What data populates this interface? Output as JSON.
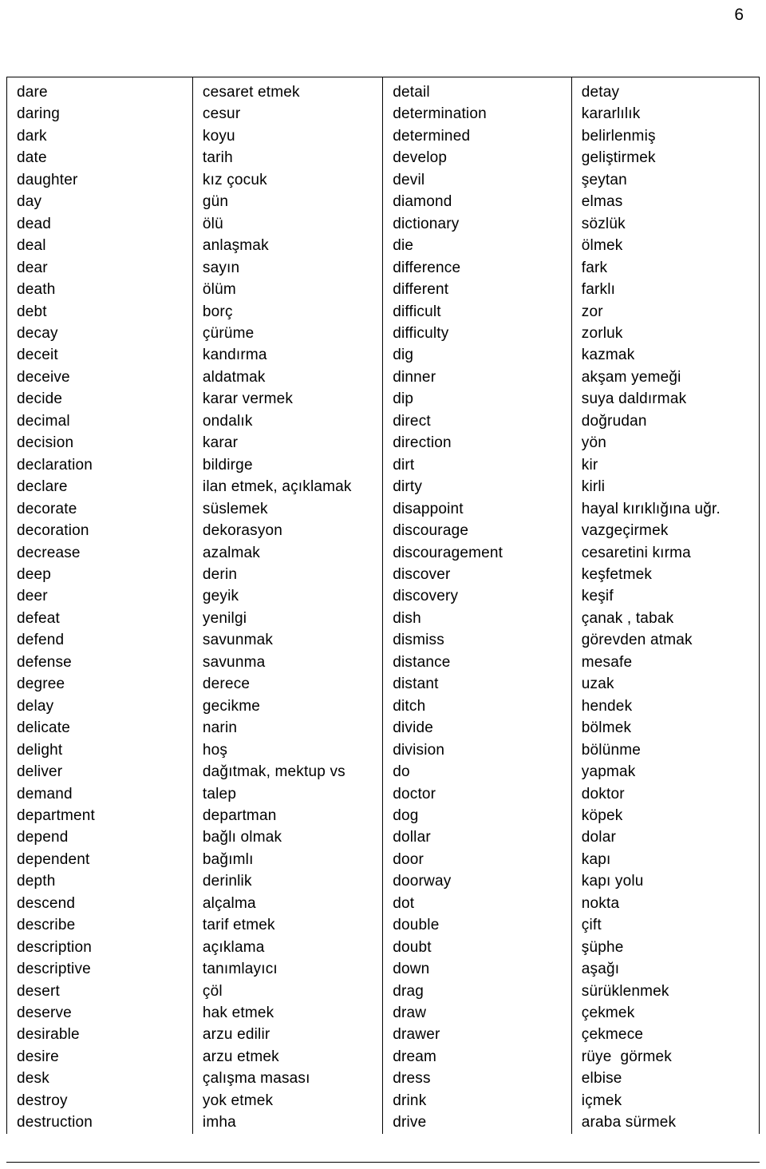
{
  "page": {
    "number": "6"
  },
  "table": {
    "columns": [
      {
        "name": "english-words-column-1",
        "entries": [
          "dare",
          "daring",
          "dark",
          "date",
          "daughter",
          "day",
          "dead",
          "deal",
          "dear",
          "death",
          "debt",
          "decay",
          "deceit",
          "deceive",
          "decide",
          "decimal",
          "decision",
          "declaration",
          "declare",
          "decorate",
          "decoration",
          "decrease",
          "deep",
          "deer",
          "defeat",
          "defend",
          "defense",
          "degree",
          "delay",
          "delicate",
          "delight",
          "deliver",
          "demand",
          "department",
          "depend",
          "dependent",
          "depth",
          "descend",
          "describe",
          "description",
          "descriptive",
          "desert",
          "deserve",
          "desirable",
          "desire",
          "desk",
          "destroy",
          "destruction"
        ]
      },
      {
        "name": "turkish-meanings-column-1",
        "entries": [
          "cesaret etmek",
          "cesur",
          "koyu",
          "tarih",
          "kız çocuk",
          "gün",
          "ölü",
          "anlaşmak",
          "sayın",
          "ölüm",
          "borç",
          "çürüme",
          "kandırma",
          "aldatmak",
          "karar vermek",
          "ondalık",
          "karar",
          "bildirge",
          "ilan etmek, açıklamak",
          "süslemek",
          "dekorasyon",
          "azalmak",
          "derin",
          "geyik",
          "yenilgi",
          "savunmak",
          "savunma",
          "derece",
          "gecikme",
          "narin",
          "hoş",
          "dağıtmak, mektup vs",
          "talep",
          "departman",
          "bağlı olmak",
          "bağımlı",
          "derinlik",
          "alçalma",
          "tarif etmek",
          "açıklama",
          "tanımlayıcı",
          "çöl",
          "hak etmek",
          "arzu edilir",
          "arzu etmek",
          "çalışma masası",
          "yok etmek",
          "imha"
        ]
      },
      {
        "name": "english-words-column-2",
        "entries": [
          "detail",
          "determination",
          "determined",
          "develop",
          "devil",
          "diamond",
          "dictionary",
          "die",
          "difference",
          "different",
          "difficult",
          "difficulty",
          "dig",
          "dinner",
          "dip",
          "direct",
          "direction",
          "dirt",
          "dirty",
          "disappoint",
          "discourage",
          "discouragement",
          "discover",
          "discovery",
          "dish",
          "dismiss",
          "distance",
          "distant",
          "ditch",
          "divide",
          "division",
          "do",
          "doctor",
          "dog",
          "dollar",
          "door",
          "doorway",
          "dot",
          "double",
          "doubt",
          "down",
          "drag",
          "draw",
          "drawer",
          "dream",
          "dress",
          "drink",
          "drive"
        ]
      },
      {
        "name": "turkish-meanings-column-2",
        "entries": [
          "detay",
          "kararlılık",
          "belirlenmiş",
          "geliştirmek",
          "şeytan",
          "elmas",
          "sözlük",
          "ölmek",
          "fark",
          "farklı",
          "zor",
          "zorluk",
          "kazmak",
          "akşam yemeği",
          "suya daldırmak",
          "doğrudan",
          "yön",
          "kir",
          "kirli",
          "hayal kırıklığına uğr.",
          "vazgeçirmek",
          "cesaretini kırma",
          "keşfetmek",
          "keşif",
          "çanak , tabak",
          "görevden atmak",
          "mesafe",
          "uzak",
          "hendek",
          "bölmek",
          "bölünme",
          "yapmak",
          "doktor",
          "köpek",
          "dolar",
          "kapı",
          "kapı yolu",
          "nokta",
          "çift",
          "şüphe",
          "aşağı",
          "sürüklenmek",
          "çekmek",
          "çekmece",
          "rüye  görmek",
          "elbise",
          "içmek",
          "araba sürmek"
        ]
      }
    ]
  }
}
